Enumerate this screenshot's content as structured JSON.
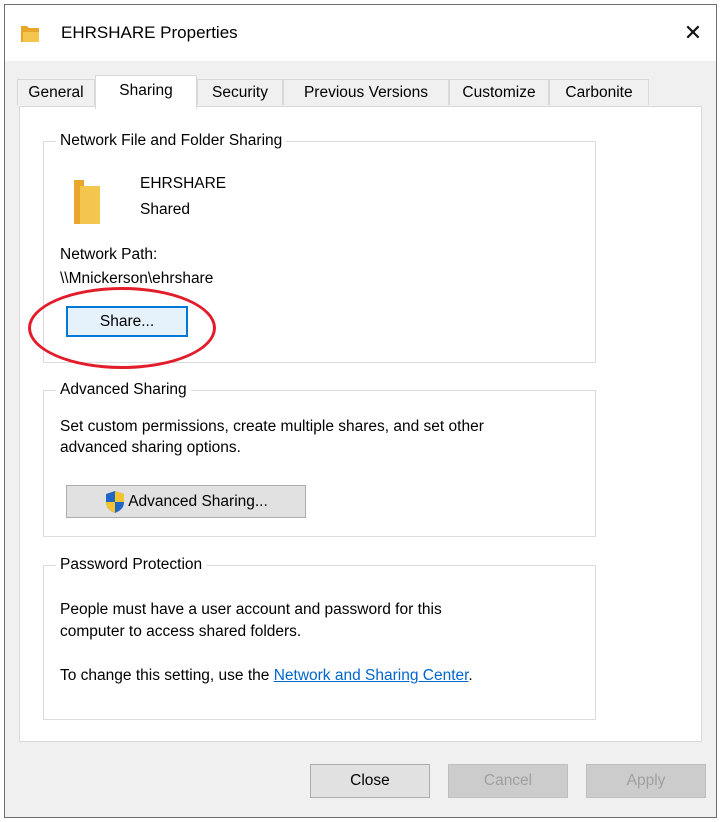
{
  "window": {
    "title": "EHRSHARE Properties",
    "close_symbol": "✕"
  },
  "tabs": [
    {
      "label": "General"
    },
    {
      "label": "Sharing"
    },
    {
      "label": "Security"
    },
    {
      "label": "Previous Versions"
    },
    {
      "label": "Customize"
    },
    {
      "label": "Carbonite"
    }
  ],
  "network_sharing": {
    "group_title": "Network File and Folder Sharing",
    "folder_name": "EHRSHARE",
    "status": "Shared",
    "path_label": "Network Path:",
    "path_value": "\\\\Mnickerson\\ehrshare",
    "share_button": "Share..."
  },
  "advanced_sharing": {
    "group_title": "Advanced Sharing",
    "description_line1": "Set custom permissions, create multiple shares, and set other",
    "description_line2": "advanced sharing options.",
    "button": "Advanced Sharing..."
  },
  "password_protection": {
    "group_title": "Password Protection",
    "line1": "People must have a user account and password for this",
    "line2": "computer to access shared folders.",
    "change_prefix": "To change this setting, use the ",
    "link_text": "Network and Sharing Center",
    "change_suffix": "."
  },
  "footer": {
    "close": "Close",
    "cancel": "Cancel",
    "apply": "Apply"
  },
  "colors": {
    "accent": "#0078d7",
    "link": "#0066cc",
    "annotation": "#e21c2a",
    "folder": "#f4c64e"
  }
}
